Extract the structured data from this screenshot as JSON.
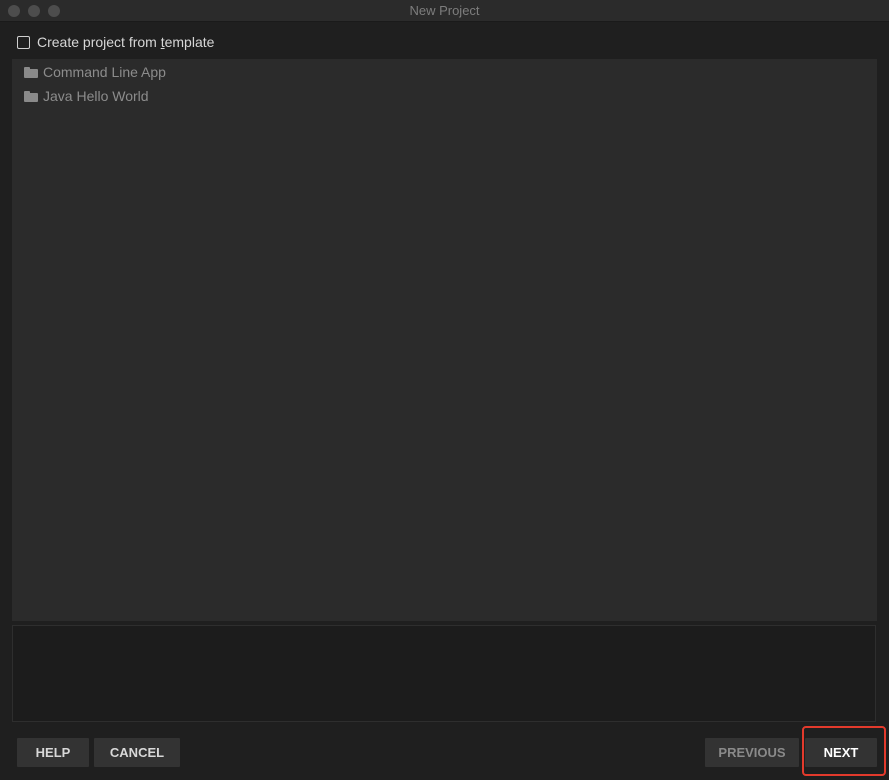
{
  "window": {
    "title": "New Project"
  },
  "template": {
    "checkbox_label_prefix": "Create project from ",
    "checkbox_label_mnemonic": "t",
    "checkbox_label_suffix": "emplate",
    "checked": false
  },
  "templates": [
    {
      "label": "Command Line App",
      "icon": "folder-icon"
    },
    {
      "label": "Java Hello World",
      "icon": "folder-icon"
    }
  ],
  "buttons": {
    "help": "HELP",
    "cancel": "CANCEL",
    "previous": "PREVIOUS",
    "next": "NEXT"
  },
  "colors": {
    "window_bg": "#1f1f1f",
    "panel_bg": "#2b2b2b",
    "button_bg": "#333333",
    "highlight": "#e33a2c"
  }
}
